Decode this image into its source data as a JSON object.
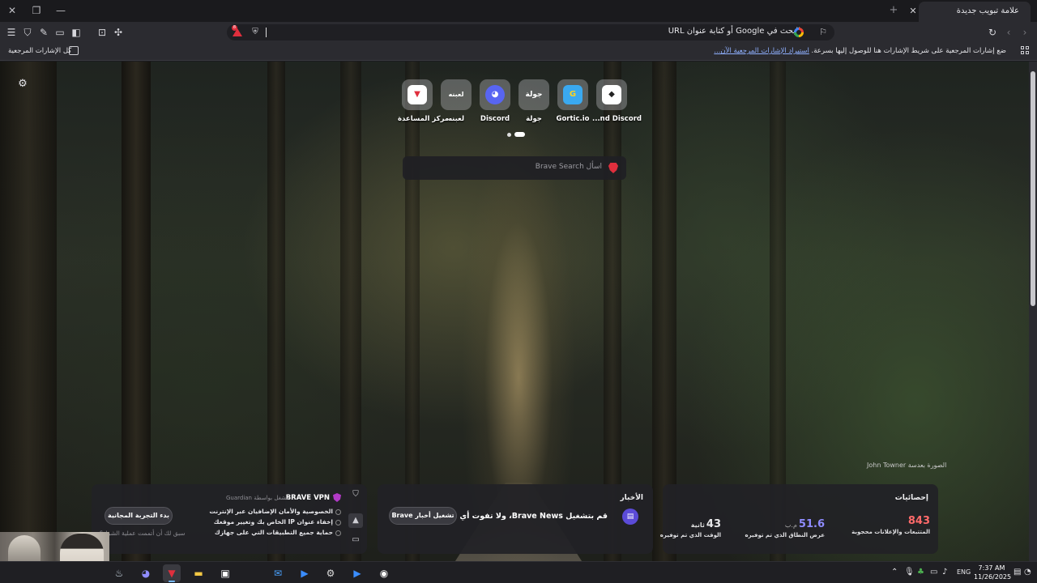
{
  "window": {
    "tab_title": "علامة تبويب جديدة",
    "close_glyph": "✕",
    "newtab_glyph": "+",
    "min_glyph": "—",
    "restore_glyph": "❐",
    "winclose_glyph": "✕"
  },
  "toolbar": {
    "url_placeholder": "البحث في Google أو كتابة عنوان URL",
    "rewards_badge": "8",
    "icons": [
      "menu-icon",
      "vpn-shield-icon",
      "brush-icon",
      "wallet-icon",
      "sidebar-icon",
      "screenshot-icon",
      "extensions-icon",
      "bookmark-icon",
      "reload-icon",
      "back-icon",
      "forward-icon"
    ]
  },
  "bookmarks_bar": {
    "hint_text": "ضع إشارات المرجعية على شريط الإشارات هنا للوصول إليها بسرعة.",
    "hint_link": "استيراد الإشارات المرجعية الآن...",
    "all_bookmarks": "كل الإشارات المرجعية"
  },
  "new_tab": {
    "top_sites": [
      {
        "label": "...nd Discord",
        "glyph": "◆",
        "bg": "#ffffff",
        "fg": "#222222"
      },
      {
        "label": "Gortic.io",
        "glyph": "G",
        "bg": "#3aa9f0",
        "fg": "#ffd21f"
      },
      {
        "label": "جولة",
        "glyph": "جولة",
        "bg": "rgba(0,0,0,0)",
        "fg": "#ffffff"
      },
      {
        "label": "Discord",
        "glyph": "◕",
        "bg": "#5865f2",
        "fg": "#ffffff"
      },
      {
        "label": "لعبنه",
        "glyph": "لعبنه",
        "bg": "rgba(0,0,0,0)",
        "fg": "#ffffff"
      },
      {
        "label": "مركز المساعدة",
        "glyph": "▼",
        "bg": "#ffffff",
        "fg": "#e02f3d"
      }
    ],
    "search_placeholder": "اسأل Brave Search",
    "photo_credit": "الصورة بعدسة John Towner"
  },
  "cards": {
    "stats": {
      "title": "إحصائيات",
      "trackers_value": "843",
      "trackers_label": "المتتبعات والإعلانات محجوبة",
      "bandwidth_value": "51.6",
      "bandwidth_unit": "م.ب",
      "bandwidth_label": "عرض النطاق الذي تم توفيره",
      "time_value": "43",
      "time_unit": "ثانية",
      "time_label": "الوقت الذي تم توفيره"
    },
    "news": {
      "title": "الأخبار",
      "text": "قم بتشغيل Brave News، ولا تفوت أي خبر",
      "button": "تشغيل أخبار Brave"
    },
    "vpn": {
      "title": "BRAVE VPN",
      "powered": "مشغل بواسطة Guardian",
      "features": [
        "الخصوصية والأمان الإضافيان عبر الإنترنت",
        "إخفاء عنوان IP الخاص بك وتغيير موقعك",
        "حماية جميع التطبيقات التي على جهازك"
      ],
      "button": "بدء التجربة المجانية",
      "footer": "سبق لك أن أتممت عملية الشراء؟"
    }
  },
  "taskbar": {
    "lang": "ENG",
    "time": "7:37 AM",
    "date": "11/26/2025"
  },
  "colors": {
    "accent": "#5b4bd8",
    "brave_red": "#e02f3d",
    "stats_trackers": "#ff6a6a",
    "stats_bandwidth": "#8f8cff",
    "stats_time": "#ffffff"
  }
}
